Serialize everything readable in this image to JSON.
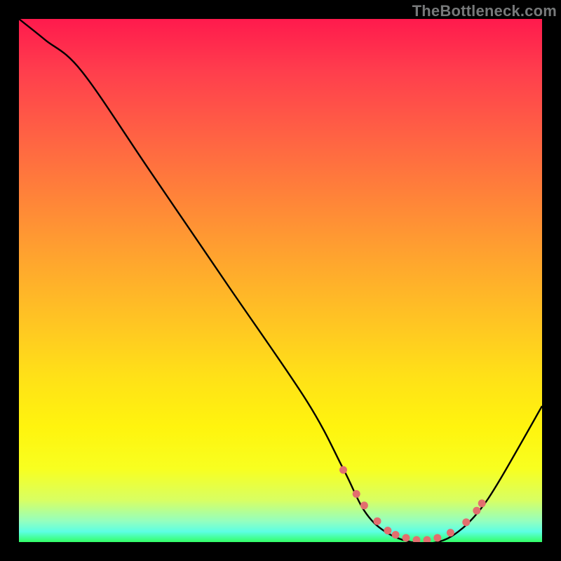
{
  "watermark": "TheBottleneck.com",
  "chart_data": {
    "type": "line",
    "title": "",
    "xlabel": "",
    "ylabel": "",
    "xlim": [
      0,
      100
    ],
    "ylim": [
      0,
      100
    ],
    "series": [
      {
        "name": "bottleneck-curve",
        "x": [
          0,
          5,
          12,
          25,
          40,
          55,
          62,
          66,
          70,
          75,
          80,
          84,
          88,
          92,
          100
        ],
        "y": [
          100,
          96,
          90,
          71,
          49,
          27,
          14,
          6,
          2,
          0,
          0,
          2,
          6,
          12,
          26
        ]
      }
    ],
    "markers": {
      "name": "highlight-dots",
      "x": [
        62.0,
        64.5,
        66.0,
        68.5,
        70.5,
        72.0,
        74.0,
        76.0,
        78.0,
        80.0,
        82.5,
        85.5,
        87.5,
        88.5
      ],
      "y": [
        13.8,
        9.2,
        7.0,
        4.0,
        2.2,
        1.4,
        0.8,
        0.4,
        0.4,
        0.8,
        1.8,
        3.8,
        6.0,
        7.4
      ]
    },
    "gradient": {
      "top_color": "#ff1a4d",
      "bottom_color": "#33ff66"
    }
  }
}
